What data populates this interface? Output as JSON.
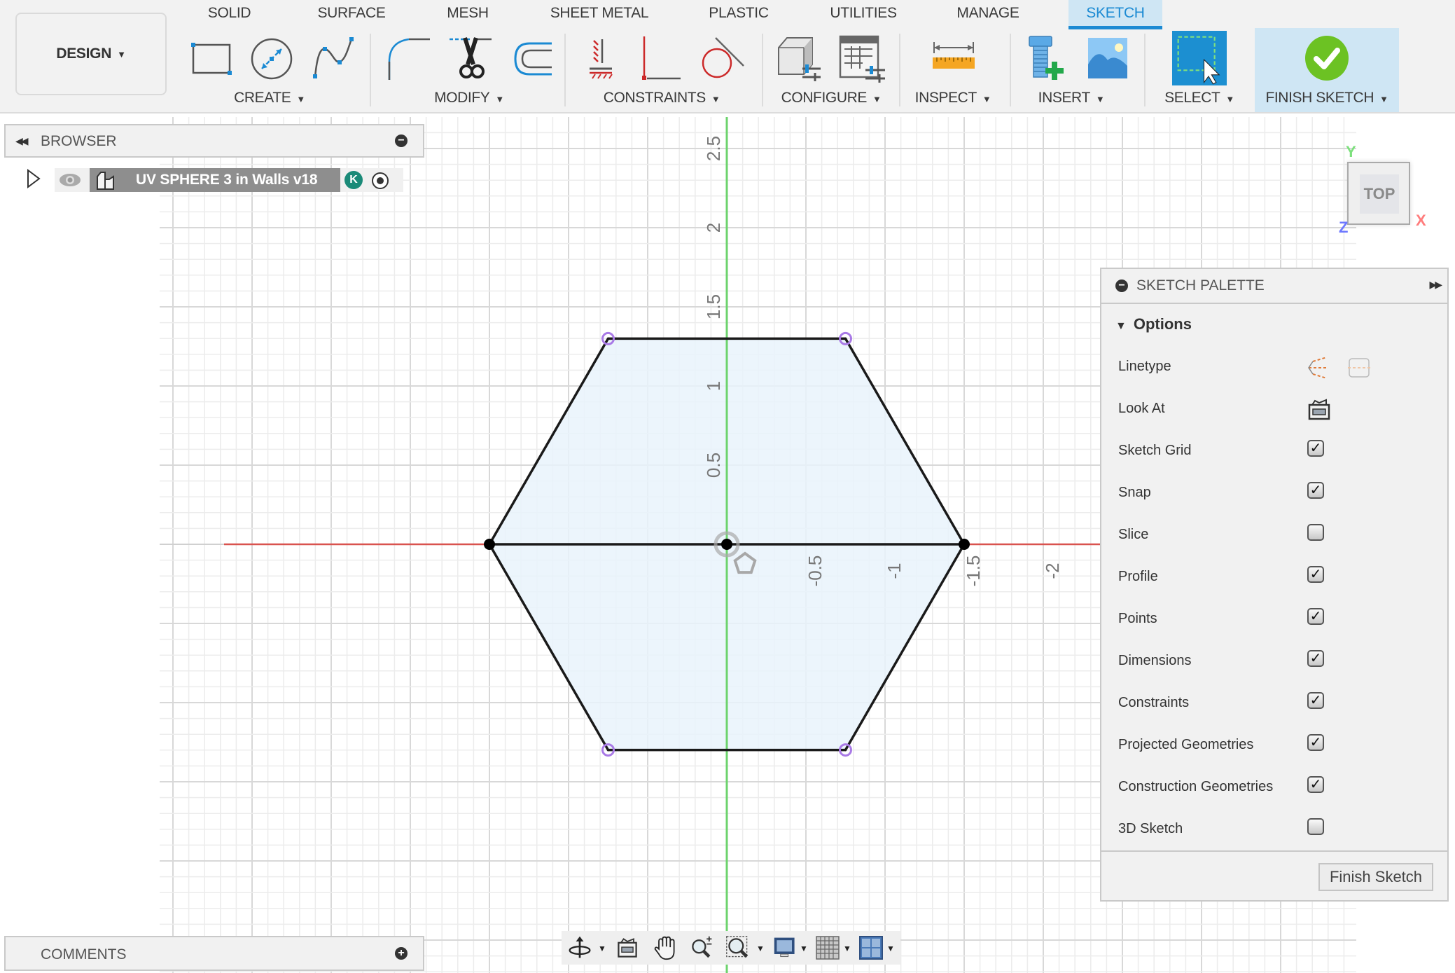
{
  "app": {
    "workspace_button": "DESIGN",
    "tabs": [
      {
        "label": "SOLID",
        "active": false
      },
      {
        "label": "SURFACE",
        "active": false
      },
      {
        "label": "MESH",
        "active": false
      },
      {
        "label": "SHEET METAL",
        "active": false
      },
      {
        "label": "PLASTIC",
        "active": false
      },
      {
        "label": "UTILITIES",
        "active": false
      },
      {
        "label": "MANAGE",
        "active": false
      },
      {
        "label": "SKETCH",
        "active": true
      }
    ],
    "groups": {
      "create": {
        "label": "CREATE",
        "tools": [
          "rectangle-icon",
          "circle-diameter-icon",
          "spline-icon"
        ]
      },
      "modify": {
        "label": "MODIFY",
        "tools": [
          "fillet-icon",
          "trim-icon",
          "offset-icon"
        ]
      },
      "constraints": {
        "label": "CONSTRAINTS",
        "tools": [
          "fix-constraint-icon",
          "perpendicular-icon",
          "tangent-icon"
        ]
      },
      "configure": {
        "label": "CONFIGURE",
        "tools": [
          "configure-model-icon",
          "configuration-table-icon"
        ]
      },
      "inspect": {
        "label": "INSPECT",
        "tools": [
          "measure-icon"
        ]
      },
      "insert": {
        "label": "INSERT",
        "tools": [
          "insert-mcmaster-icon",
          "insert-canvas-icon"
        ]
      },
      "select": {
        "label": "SELECT",
        "tools": [
          "window-select-icon"
        ]
      },
      "finish": {
        "label": "FINISH SKETCH",
        "tools": [
          "finish-sketch-check-icon"
        ]
      }
    },
    "accent_color": "#1b8ad3"
  },
  "browser": {
    "title": "BROWSER",
    "document_name": "UV SPHERE 3 in Walls v18",
    "user_badge": "K"
  },
  "comments": {
    "title": "COMMENTS"
  },
  "sketch_palette": {
    "title": "SKETCH PALETTE",
    "section": "Options",
    "options": [
      {
        "label": "Linetype",
        "type": "linetype"
      },
      {
        "label": "Look At",
        "type": "lookat"
      },
      {
        "label": "Sketch Grid",
        "type": "checkbox",
        "checked": true
      },
      {
        "label": "Snap",
        "type": "checkbox",
        "checked": true
      },
      {
        "label": "Slice",
        "type": "checkbox",
        "checked": false
      },
      {
        "label": "Profile",
        "type": "checkbox",
        "checked": true
      },
      {
        "label": "Points",
        "type": "checkbox",
        "checked": true
      },
      {
        "label": "Dimensions",
        "type": "checkbox",
        "checked": true
      },
      {
        "label": "Constraints",
        "type": "checkbox",
        "checked": true
      },
      {
        "label": "Projected Geometries",
        "type": "checkbox",
        "checked": true
      },
      {
        "label": "Construction Geometries",
        "type": "checkbox",
        "checked": true
      },
      {
        "label": "3D Sketch",
        "type": "checkbox",
        "checked": false
      }
    ],
    "finish_button": "Finish Sketch"
  },
  "viewcube": {
    "face": "TOP",
    "axes": {
      "x": "X",
      "y": "Y",
      "z": "Z"
    }
  },
  "sketch": {
    "shape": "regular hexagon",
    "circumradius": 1.5,
    "center": [
      0,
      0
    ],
    "x_axis_labels": [
      "-0.5",
      "-1",
      "-1.5",
      "-2"
    ],
    "x_axis_values": [
      0.5,
      1,
      1.5,
      2
    ],
    "y_axis_labels": [
      "0.5",
      "1",
      "1.5",
      "2",
      "2.5"
    ],
    "y_axis_values": [
      0.5,
      1,
      1.5,
      2,
      2.5
    ],
    "profile_fill": "#e9f3fb",
    "line_color": "#1a1a1a",
    "x_axis_color": "#d9534f",
    "y_axis_color": "#6dd36d",
    "vertex_marker_color": "#a97ae6"
  },
  "navbar": {
    "tools": [
      "orbit-icon",
      "look-at-icon",
      "pan-icon",
      "zoom-icon",
      "fit-window-icon",
      "display-settings-icon",
      "grid-snap-icon",
      "viewports-icon"
    ]
  }
}
